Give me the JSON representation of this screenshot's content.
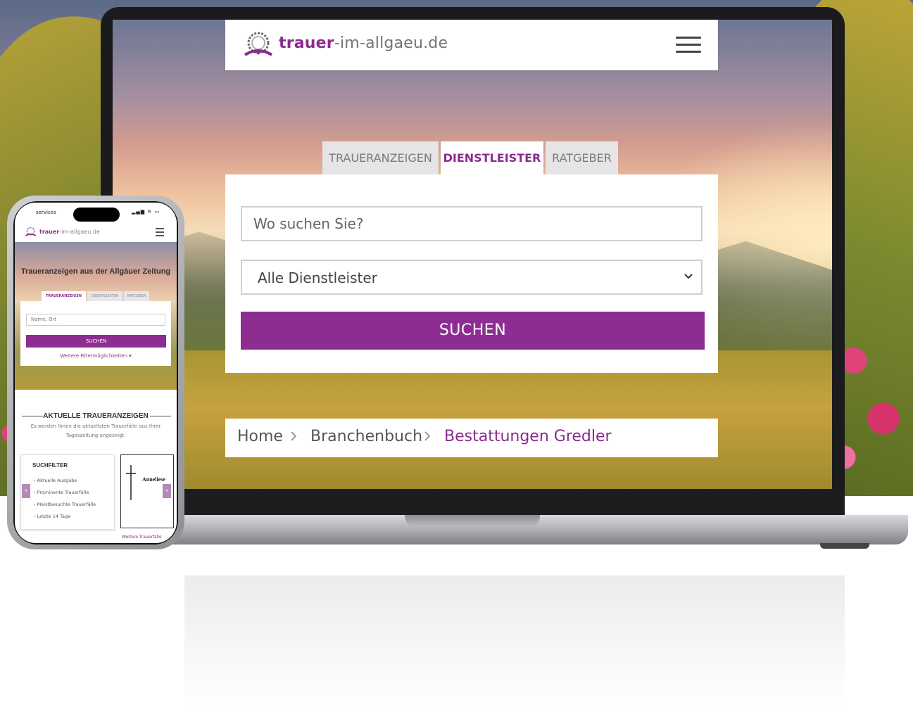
{
  "site": {
    "logo_main": "trauer",
    "logo_rest": "-im-allgaeu.de",
    "menu_icon": "hamburger-icon",
    "brand_color": "#8d2d91"
  },
  "tabs": [
    {
      "label": "TRAUERANZEIGEN",
      "active": false
    },
    {
      "label": "DIENSTLEISTER",
      "active": true
    },
    {
      "label": "RATGEBER",
      "active": false
    }
  ],
  "search": {
    "where_placeholder": "Wo suchen Sie?",
    "category_selected": "Alle Dienstleister",
    "button_label": "SUCHEN"
  },
  "breadcrumb": [
    {
      "label": "Home",
      "current": false
    },
    {
      "label": "Branchenbuch",
      "current": false
    },
    {
      "label": "Bestattungen Gredler",
      "current": true
    }
  ],
  "phone": {
    "carrier": "services",
    "status_icons": "▂▄▆ ≋ ▭",
    "logo_main": "trauer",
    "logo_rest": "-im-allgaeu.de",
    "hero_title": "Traueranzeigen aus der Allgäuer Zeitung",
    "tabs": [
      "TRAUERANZEIGEN",
      "DIENSTLEISTER",
      "RATGEBER"
    ],
    "input_placeholder": "Name, Ort",
    "button_label": "SUCHEN",
    "more_filters": "Weitere Filtermöglichkeiten ▾",
    "section_title": "AKTUELLE TRAUERANZEIGEN",
    "section_sub": "Es werden Ihnen die aktuellsten Trauerfälle aus Ihrer Tageszeitung angezeigt.",
    "filter_title": "SUCHFILTER",
    "filter_items": [
      "Aktuelle Ausgabe",
      "Prominente Trauerfälle",
      "Meistbesuchte Trauerfälle",
      "Letzte 14 Tage"
    ],
    "card_name": "Anneliese",
    "more_link": "Weitere Trauerfälle"
  }
}
